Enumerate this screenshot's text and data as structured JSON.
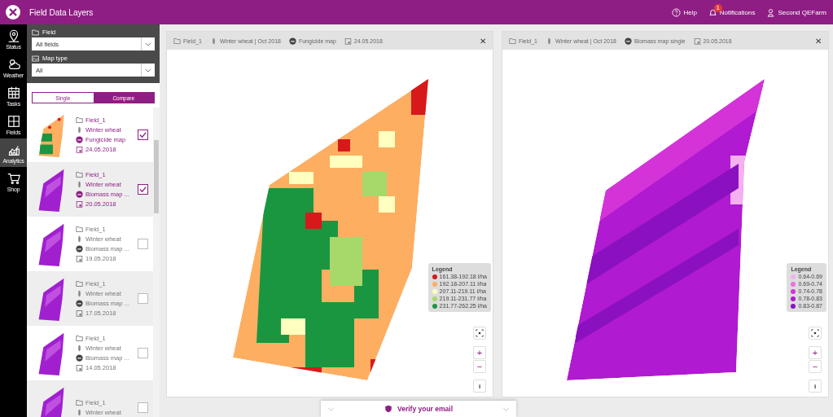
{
  "header": {
    "title": "Field Data Layers",
    "help": "Help",
    "notifications": "Notifications",
    "notification_count": "1",
    "user": "Second QEFarm"
  },
  "nav": [
    {
      "label": "Status",
      "kind": "pin",
      "selected": false
    },
    {
      "label": "Weather",
      "kind": "weather",
      "selected": false
    },
    {
      "label": "Tasks",
      "kind": "tasks",
      "selected": false
    },
    {
      "label": "Fields",
      "kind": "fields",
      "selected": false
    },
    {
      "label": "Analytics",
      "kind": "analytics",
      "selected": true
    },
    {
      "label": "Shop",
      "kind": "cart",
      "selected": false
    }
  ],
  "filters": {
    "field_label": "Field",
    "field_value": "All fields",
    "map_type_label": "Map type",
    "map_type_value": "All"
  },
  "mode_toggle": [
    {
      "label": "Single",
      "selected": false
    },
    {
      "label": "Compare",
      "selected": true
    }
  ],
  "items": [
    {
      "field": "Field_1",
      "crop": "Winter wheat",
      "map_type": "Fungicide map",
      "date": "24.05.2018",
      "checked": true,
      "kind": "fungicide"
    },
    {
      "field": "Field_1",
      "crop": "Winter wheat",
      "map_type": "Biomass map ...",
      "date": "20.05.2018",
      "checked": true,
      "kind": "biomass"
    },
    {
      "field": "Field_1",
      "crop": "Winter wheat",
      "map_type": "Biomass map ...",
      "date": "19.05.2018",
      "checked": false,
      "kind": "biomass"
    },
    {
      "field": "Field_1",
      "crop": "Winter wheat",
      "map_type": "Biomass map ...",
      "date": "17.05.2018",
      "checked": false,
      "kind": "biomass"
    },
    {
      "field": "Field_1",
      "crop": "Winter wheat",
      "map_type": "Biomass map ...",
      "date": "14.05.2018",
      "checked": false,
      "kind": "biomass"
    },
    {
      "field": "Field_1",
      "crop": "Winter wheat",
      "checked": false,
      "kind": "biomass"
    }
  ],
  "panels": [
    {
      "field": "Field_1",
      "crop": "Winter wheat | Oct 2018",
      "map_type": "Fungicide map",
      "date": "24.05.2018",
      "kind": "fungicide",
      "close": "✕",
      "zoom_in": "+",
      "zoom_out": "−",
      "info": "i",
      "legend_title": "Legend",
      "legend": [
        {
          "label": "161.38-192.18 l/ha",
          "color": "#d7191c"
        },
        {
          "label": "192.18-207.11 l/ha",
          "color": "#fdae61"
        },
        {
          "label": "207.11-219.11 l/ha",
          "color": "#ffffbf"
        },
        {
          "label": "219.11-231.77 l/ha",
          "color": "#a6d96a"
        },
        {
          "label": "231.77-262.25 l/ha",
          "color": "#1a9641"
        }
      ]
    },
    {
      "field": "Field_1",
      "crop": "Winter wheat | Oct 2018",
      "map_type": "Biomass map single",
      "date": "20.05.2018",
      "kind": "biomass",
      "close": "✕",
      "zoom_in": "+",
      "zoom_out": "−",
      "info": "i",
      "legend_title": "Legend",
      "legend": [
        {
          "label": "0.64-0.69",
          "color": "#f5b0f0"
        },
        {
          "label": "0.69-0.74",
          "color": "#ec6ee6"
        },
        {
          "label": "0.74-0.78",
          "color": "#d433d8"
        },
        {
          "label": "0.78-0.83",
          "color": "#b01ad0"
        },
        {
          "label": "0.83-0.87",
          "color": "#8a10c0"
        }
      ]
    }
  ],
  "verify_banner": "Verify your email"
}
